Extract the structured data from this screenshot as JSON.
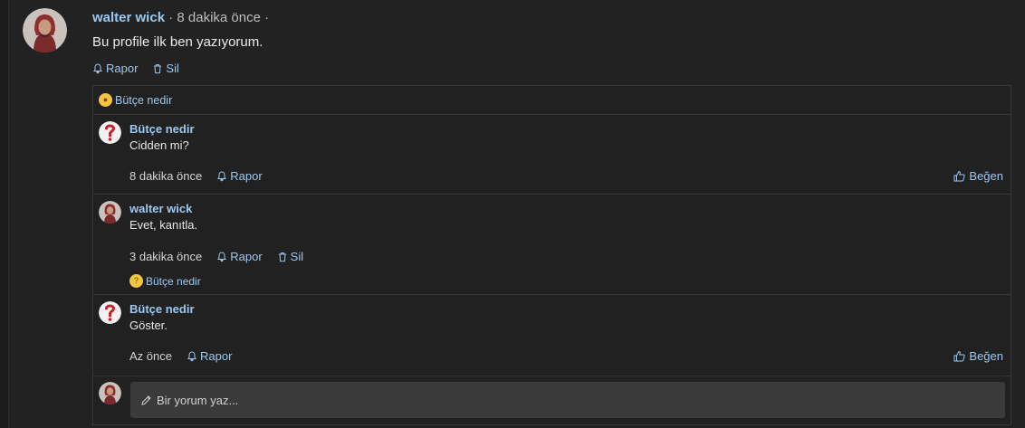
{
  "post": {
    "author": "walter wick",
    "time": "· 8 dakika önce ·",
    "body": "Bu profile ilk ben yazıyorum.",
    "report_label": "Rapor",
    "delete_label": "Sil"
  },
  "thread": {
    "top_reaction_user": "Bütçe nedir",
    "replies": [
      {
        "author": "Bütçe nedir",
        "text": "Cidden mi?",
        "time": "8 dakika önce",
        "report_label": "Rapor",
        "like_label": "Beğen"
      },
      {
        "author": "walter wick",
        "text": "Evet, kanıtla.",
        "time": "3 dakika önce",
        "report_label": "Rapor",
        "delete_label": "Sil",
        "reaction_user": "Bütçe nedir"
      },
      {
        "author": "Bütçe nedir",
        "text": "Göster.",
        "time": "Az önce",
        "report_label": "Rapor",
        "like_label": "Beğen"
      }
    ],
    "composer_placeholder": "Bir yorum yaz..."
  },
  "colors": {
    "background": "#222222",
    "link": "#9ec8f0",
    "border": "#363636",
    "composer": "#3a3a3a"
  }
}
